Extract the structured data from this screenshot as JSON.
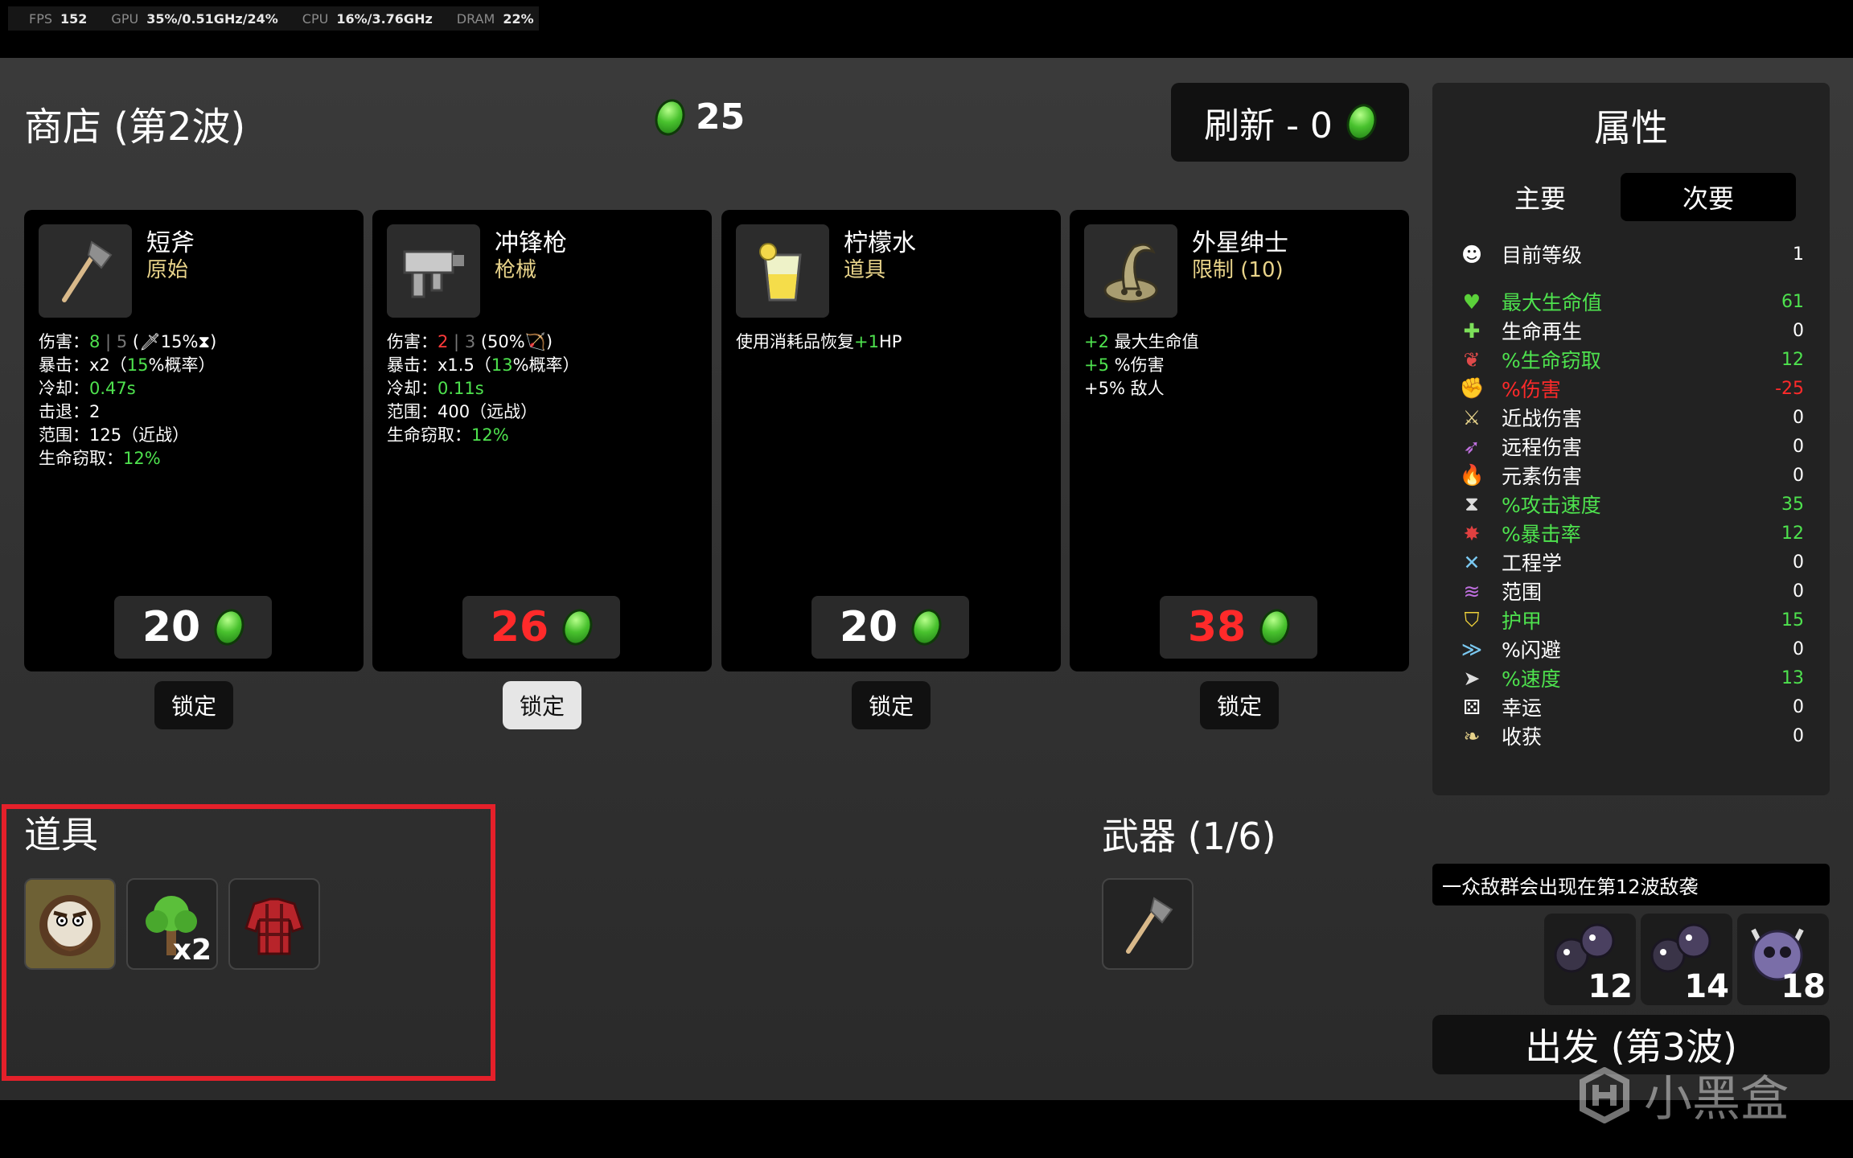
{
  "osd": {
    "fps_label": "FPS",
    "fps": "152",
    "gpu_label": "GPU",
    "gpu": "35%/0.51GHz/24%",
    "cpu_label": "CPU",
    "cpu": "16%/3.76GHz",
    "dram_label": "DRAM",
    "dram": "22%"
  },
  "shop": {
    "title": "商店 (第2波)",
    "money": "25",
    "refresh_label": "刷新 - 0"
  },
  "cards": [
    {
      "name": "短斧",
      "tier": "原始",
      "price": "20",
      "price_red": false,
      "lock": "锁定",
      "stats": [
        {
          "label": "伤害：",
          "parts": [
            {
              "t": "8",
              "c": "g"
            },
            {
              "t": " | ",
              "c": "dim"
            },
            {
              "t": "5",
              "c": "dim"
            },
            {
              "t": " (🗡15%⧗)",
              "c": ""
            }
          ]
        },
        {
          "label": "暴击：",
          "parts": [
            {
              "t": "x2（",
              "c": ""
            },
            {
              "t": "15",
              "c": "g"
            },
            {
              "t": "%概率）",
              "c": ""
            }
          ]
        },
        {
          "label": "冷却：",
          "parts": [
            {
              "t": "0.47s",
              "c": "g"
            }
          ]
        },
        {
          "label": "击退：",
          "parts": [
            {
              "t": "2",
              "c": ""
            }
          ]
        },
        {
          "label": "范围：",
          "parts": [
            {
              "t": "125（近战）",
              "c": ""
            }
          ]
        },
        {
          "label": "生命窃取：",
          "parts": [
            {
              "t": "12%",
              "c": "g"
            }
          ]
        }
      ]
    },
    {
      "name": "冲锋枪",
      "tier": "枪械",
      "price": "26",
      "price_red": true,
      "lock": "锁定",
      "stats": [
        {
          "label": "伤害：",
          "parts": [
            {
              "t": "2",
              "c": "r"
            },
            {
              "t": " | ",
              "c": "dim"
            },
            {
              "t": "3",
              "c": "dim"
            },
            {
              "t": " (50%🏹)",
              "c": ""
            }
          ]
        },
        {
          "label": "暴击：",
          "parts": [
            {
              "t": "x1.5（",
              "c": ""
            },
            {
              "t": "13",
              "c": "g"
            },
            {
              "t": "%概率）",
              "c": ""
            }
          ]
        },
        {
          "label": "冷却：",
          "parts": [
            {
              "t": "0.11s",
              "c": "g"
            }
          ]
        },
        {
          "label": "范围：",
          "parts": [
            {
              "t": "400（远战）",
              "c": ""
            }
          ]
        },
        {
          "label": "生命窃取：",
          "parts": [
            {
              "t": "12%",
              "c": "g"
            }
          ]
        }
      ]
    },
    {
      "name": "柠檬水",
      "tier": "道具",
      "price": "20",
      "price_red": false,
      "lock": "锁定",
      "stats": [
        {
          "label": "使用消耗品恢复",
          "parts": [
            {
              "t": "+1",
              "c": "g"
            },
            {
              "t": "HP",
              "c": ""
            }
          ]
        }
      ]
    },
    {
      "name": "外星绅士",
      "tier": "限制 (10)",
      "price": "38",
      "price_red": true,
      "lock": "锁定",
      "stats": [
        {
          "label": "",
          "parts": [
            {
              "t": "+2",
              "c": "g"
            },
            {
              "t": " 最大生命值",
              "c": ""
            }
          ]
        },
        {
          "label": "",
          "parts": [
            {
              "t": "+5",
              "c": "g"
            },
            {
              "t": " %伤害",
              "c": ""
            }
          ]
        },
        {
          "label": "",
          "parts": [
            {
              "t": "+5% 敌人",
              "c": ""
            }
          ]
        }
      ]
    }
  ],
  "items": {
    "title": "道具",
    "tree_count": "x2"
  },
  "weapons": {
    "title": "武器 (1/6)"
  },
  "attributes": {
    "title": "属性",
    "tab_primary": "主要",
    "tab_secondary": "次要",
    "rows": [
      {
        "label": "目前等级",
        "value": "1",
        "color": "#ffffff",
        "icon": "level-icon"
      },
      {
        "label": "最大生命值",
        "value": "61",
        "color": "#4ee24e",
        "icon": "heart-icon"
      },
      {
        "label": "生命再生",
        "value": "0",
        "color": "#ffffff",
        "icon": "regen-icon"
      },
      {
        "label": "%生命窃取",
        "value": "12",
        "color": "#4ee24e",
        "icon": "lifesteal-icon"
      },
      {
        "label": "%伤害",
        "value": "-25",
        "color": "#ff2a2a",
        "icon": "damage-icon"
      },
      {
        "label": "近战伤害",
        "value": "0",
        "color": "#ffffff",
        "icon": "melee-icon"
      },
      {
        "label": "远程伤害",
        "value": "0",
        "color": "#ffffff",
        "icon": "ranged-icon"
      },
      {
        "label": "元素伤害",
        "value": "0",
        "color": "#ffffff",
        "icon": "elemental-icon"
      },
      {
        "label": "%攻击速度",
        "value": "35",
        "color": "#4ee24e",
        "icon": "hourglass-icon"
      },
      {
        "label": "%暴击率",
        "value": "12",
        "color": "#4ee24e",
        "icon": "crit-icon"
      },
      {
        "label": "工程学",
        "value": "0",
        "color": "#ffffff",
        "icon": "engineering-icon"
      },
      {
        "label": "范围",
        "value": "0",
        "color": "#ffffff",
        "icon": "range-icon"
      },
      {
        "label": "护甲",
        "value": "15",
        "color": "#4ee24e",
        "icon": "armor-icon"
      },
      {
        "label": "%闪避",
        "value": "0",
        "color": "#ffffff",
        "icon": "dodge-icon"
      },
      {
        "label": "%速度",
        "value": "13",
        "color": "#4ee24e",
        "icon": "speed-icon"
      },
      {
        "label": "幸运",
        "value": "0",
        "color": "#ffffff",
        "icon": "dice-icon"
      },
      {
        "label": "收获",
        "value": "0",
        "color": "#ffffff",
        "icon": "harvest-icon"
      }
    ]
  },
  "wave": {
    "info": "一众敌群会出现在第12波敌袭",
    "enemies": [
      {
        "count": "12"
      },
      {
        "count": "14"
      },
      {
        "count": "18"
      }
    ],
    "go_label": "出发 (第3波)"
  },
  "watermark": "小黑盒"
}
